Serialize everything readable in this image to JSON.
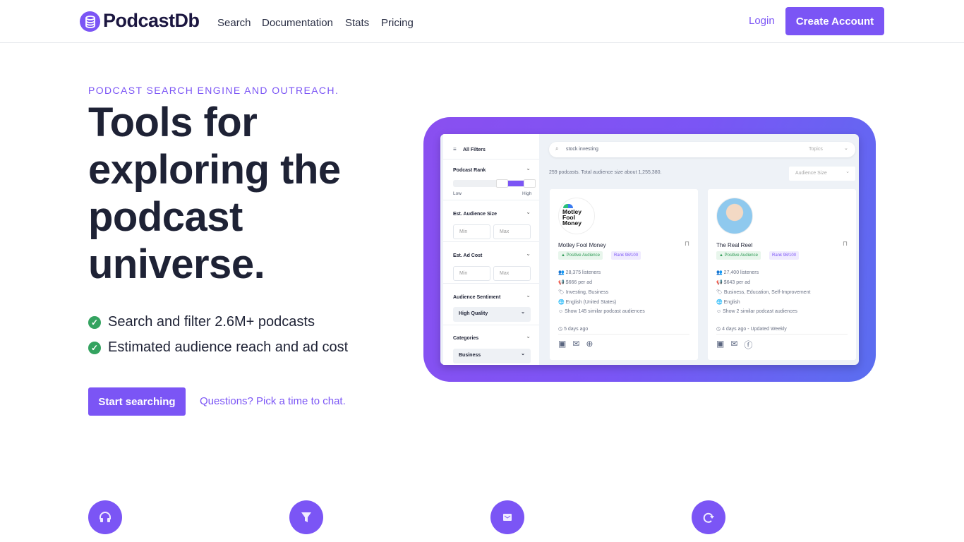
{
  "header": {
    "logo": "PodcastDb",
    "nav": [
      "Search",
      "Documentation",
      "Stats",
      "Pricing"
    ],
    "login": "Login",
    "create_account": "Create Account"
  },
  "hero": {
    "eyebrow": "PODCAST SEARCH ENGINE AND OUTREACH.",
    "title": "Tools for exploring the podcast universe.",
    "bullets": [
      "Search and filter 2.6M+ podcasts",
      "Estimated audience reach and ad cost"
    ],
    "start": "Start searching",
    "chat": "Questions? Pick a time to chat."
  },
  "mockup": {
    "filters": {
      "title": "All Filters",
      "rank": "Podcast Rank",
      "low": "Low",
      "high": "High",
      "audience": "Est. Audience Size",
      "adcost": "Est. Ad Cost",
      "min": "Min",
      "max": "Max",
      "sentiment": "Audience Sentiment",
      "sentiment_value": "High Quality",
      "categories": "Categories",
      "categories_value": "Business"
    },
    "search": {
      "value": "stock investing",
      "topics": "Topics"
    },
    "summary": "259 podcasts. Total audience size about 1,255,380.",
    "sort": "Audience Size",
    "cards": [
      {
        "title": "Motley Fool Money",
        "logo_text": "Motley Fool Money",
        "sentiment": "Positive Audience",
        "rank": "Rank 98/100",
        "listeners": "28,375 listeners",
        "ad": "$666 per ad",
        "tags": "Investing, Business",
        "language": "English (United States)",
        "similar": "Show 145 similar podcast audiences",
        "updated": "5 days ago",
        "links": [
          "rss",
          "email",
          "web"
        ]
      },
      {
        "title": "The Real Reel",
        "sentiment": "Positive Audience",
        "rank": "Rank 98/100",
        "listeners": "27,400 listeners",
        "ad": "$643 per ad",
        "tags": "Business, Education, Self-Improvement",
        "language": "English",
        "similar": "Show 2 similar podcast audiences",
        "updated": "4 days ago - Updated Weekly",
        "links": [
          "rss",
          "email",
          "facebook"
        ]
      }
    ]
  },
  "features": [
    "headphones-icon",
    "filter-icon",
    "envelope-icon",
    "refresh-icon"
  ],
  "colors": {
    "accent": "#7b55f5",
    "check": "#34a360"
  }
}
